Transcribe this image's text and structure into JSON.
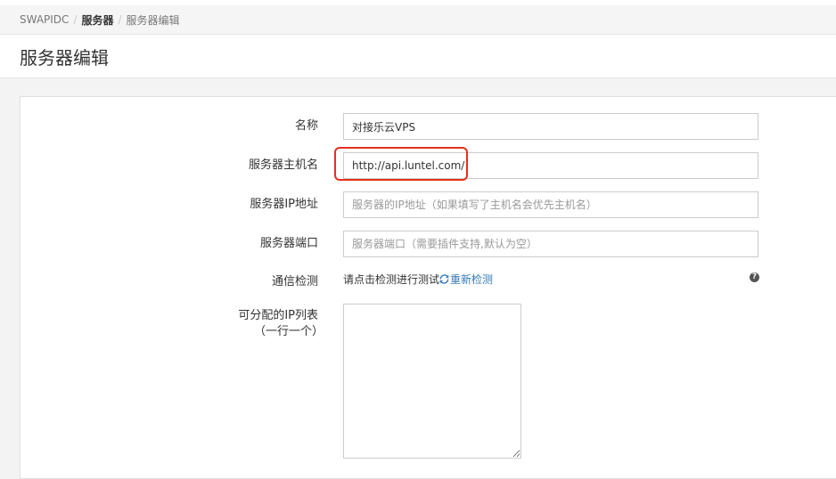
{
  "breadcrumb": {
    "root": "SWAPIDC",
    "section": "服务器",
    "current": "服务器编辑"
  },
  "page": {
    "title": "服务器编辑"
  },
  "form": {
    "name": {
      "label": "名称",
      "value": "对接乐云VPS"
    },
    "hostname": {
      "label": "服务器主机名",
      "value": "http://api.luntel.com/"
    },
    "ip": {
      "label": "服务器IP地址",
      "value": "",
      "placeholder": "服务器的IP地址（如果填写了主机名会优先主机名）"
    },
    "port": {
      "label": "服务器端口",
      "value": "",
      "placeholder": "服务器端口（需要插件支持,默认为空）"
    },
    "connection_check": {
      "label": "通信检测",
      "hint": "请点击检测进行测试",
      "link_label": "重新检测",
      "help_icon": "?"
    },
    "ip_list": {
      "label_line1": "可分配的IP列表",
      "label_line2": "（一行一个）",
      "value": ""
    }
  },
  "colors": {
    "highlight_border": "#e3311d",
    "link": "#337ab7"
  },
  "icons": [
    "refresh-icon",
    "help-icon"
  ]
}
